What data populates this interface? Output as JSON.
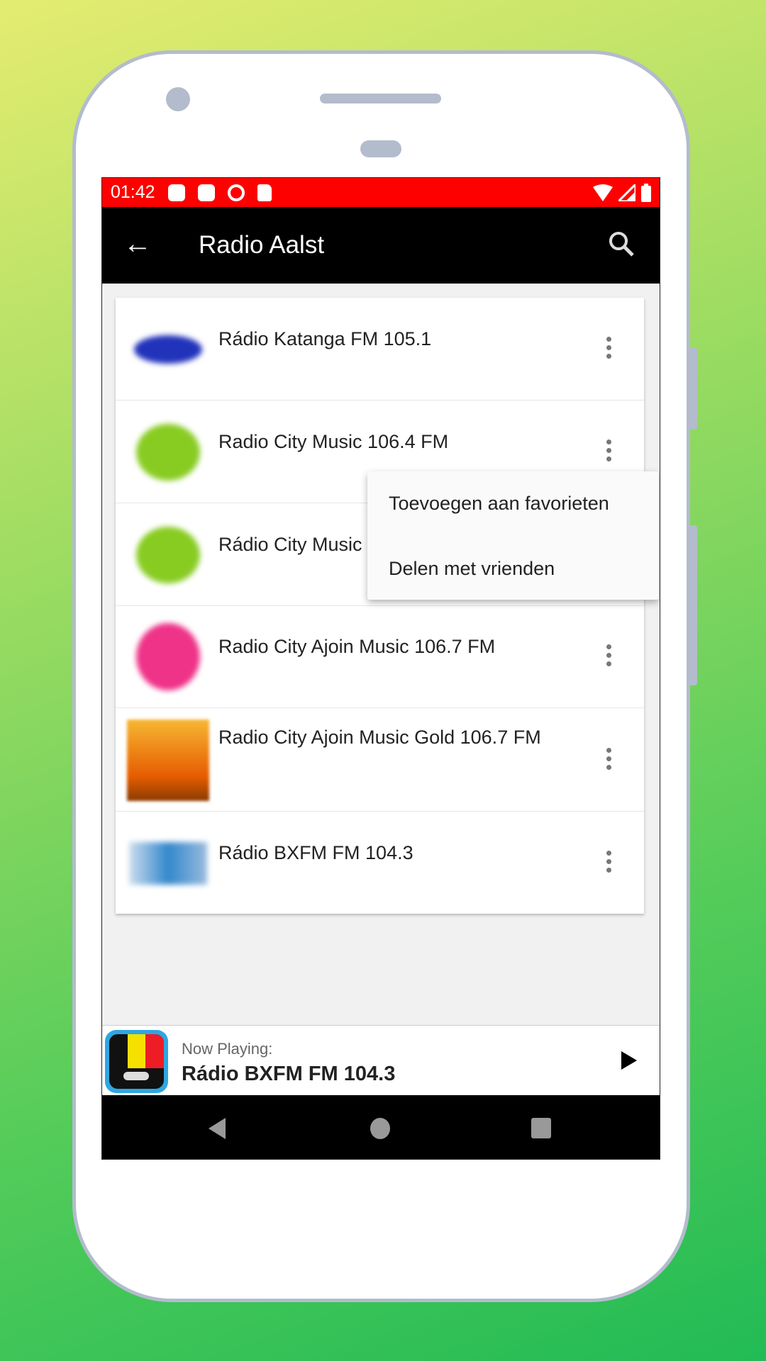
{
  "status_bar": {
    "time": "01:42",
    "color": "#ff0000"
  },
  "toolbar": {
    "title": "Radio Aalst",
    "back_icon": "arrow-back-icon",
    "search_icon": "search-icon"
  },
  "stations": [
    {
      "name": "Rádio Katanga FM 105.1",
      "logo_color": "#2233bb"
    },
    {
      "name": "Radio City Music 106.4 FM",
      "logo_color": "#88cc22"
    },
    {
      "name": "Rádio City Music",
      "logo_color": "#88cc22"
    },
    {
      "name": "Radio City Ajoin Music 106.7 FM",
      "logo_color": "#ee3388"
    },
    {
      "name": "Radio City Ajoin Music Gold 106.7 FM",
      "logo_color": "#ee8800"
    },
    {
      "name": "Rádio BXFM FM 104.3",
      "logo_color": "#3388cc"
    }
  ],
  "context_menu": {
    "items": [
      "Toevoegen aan favorieten",
      "Delen met vrienden"
    ]
  },
  "now_playing": {
    "label": "Now Playing:",
    "title": "Rádio BXFM FM 104.3"
  }
}
